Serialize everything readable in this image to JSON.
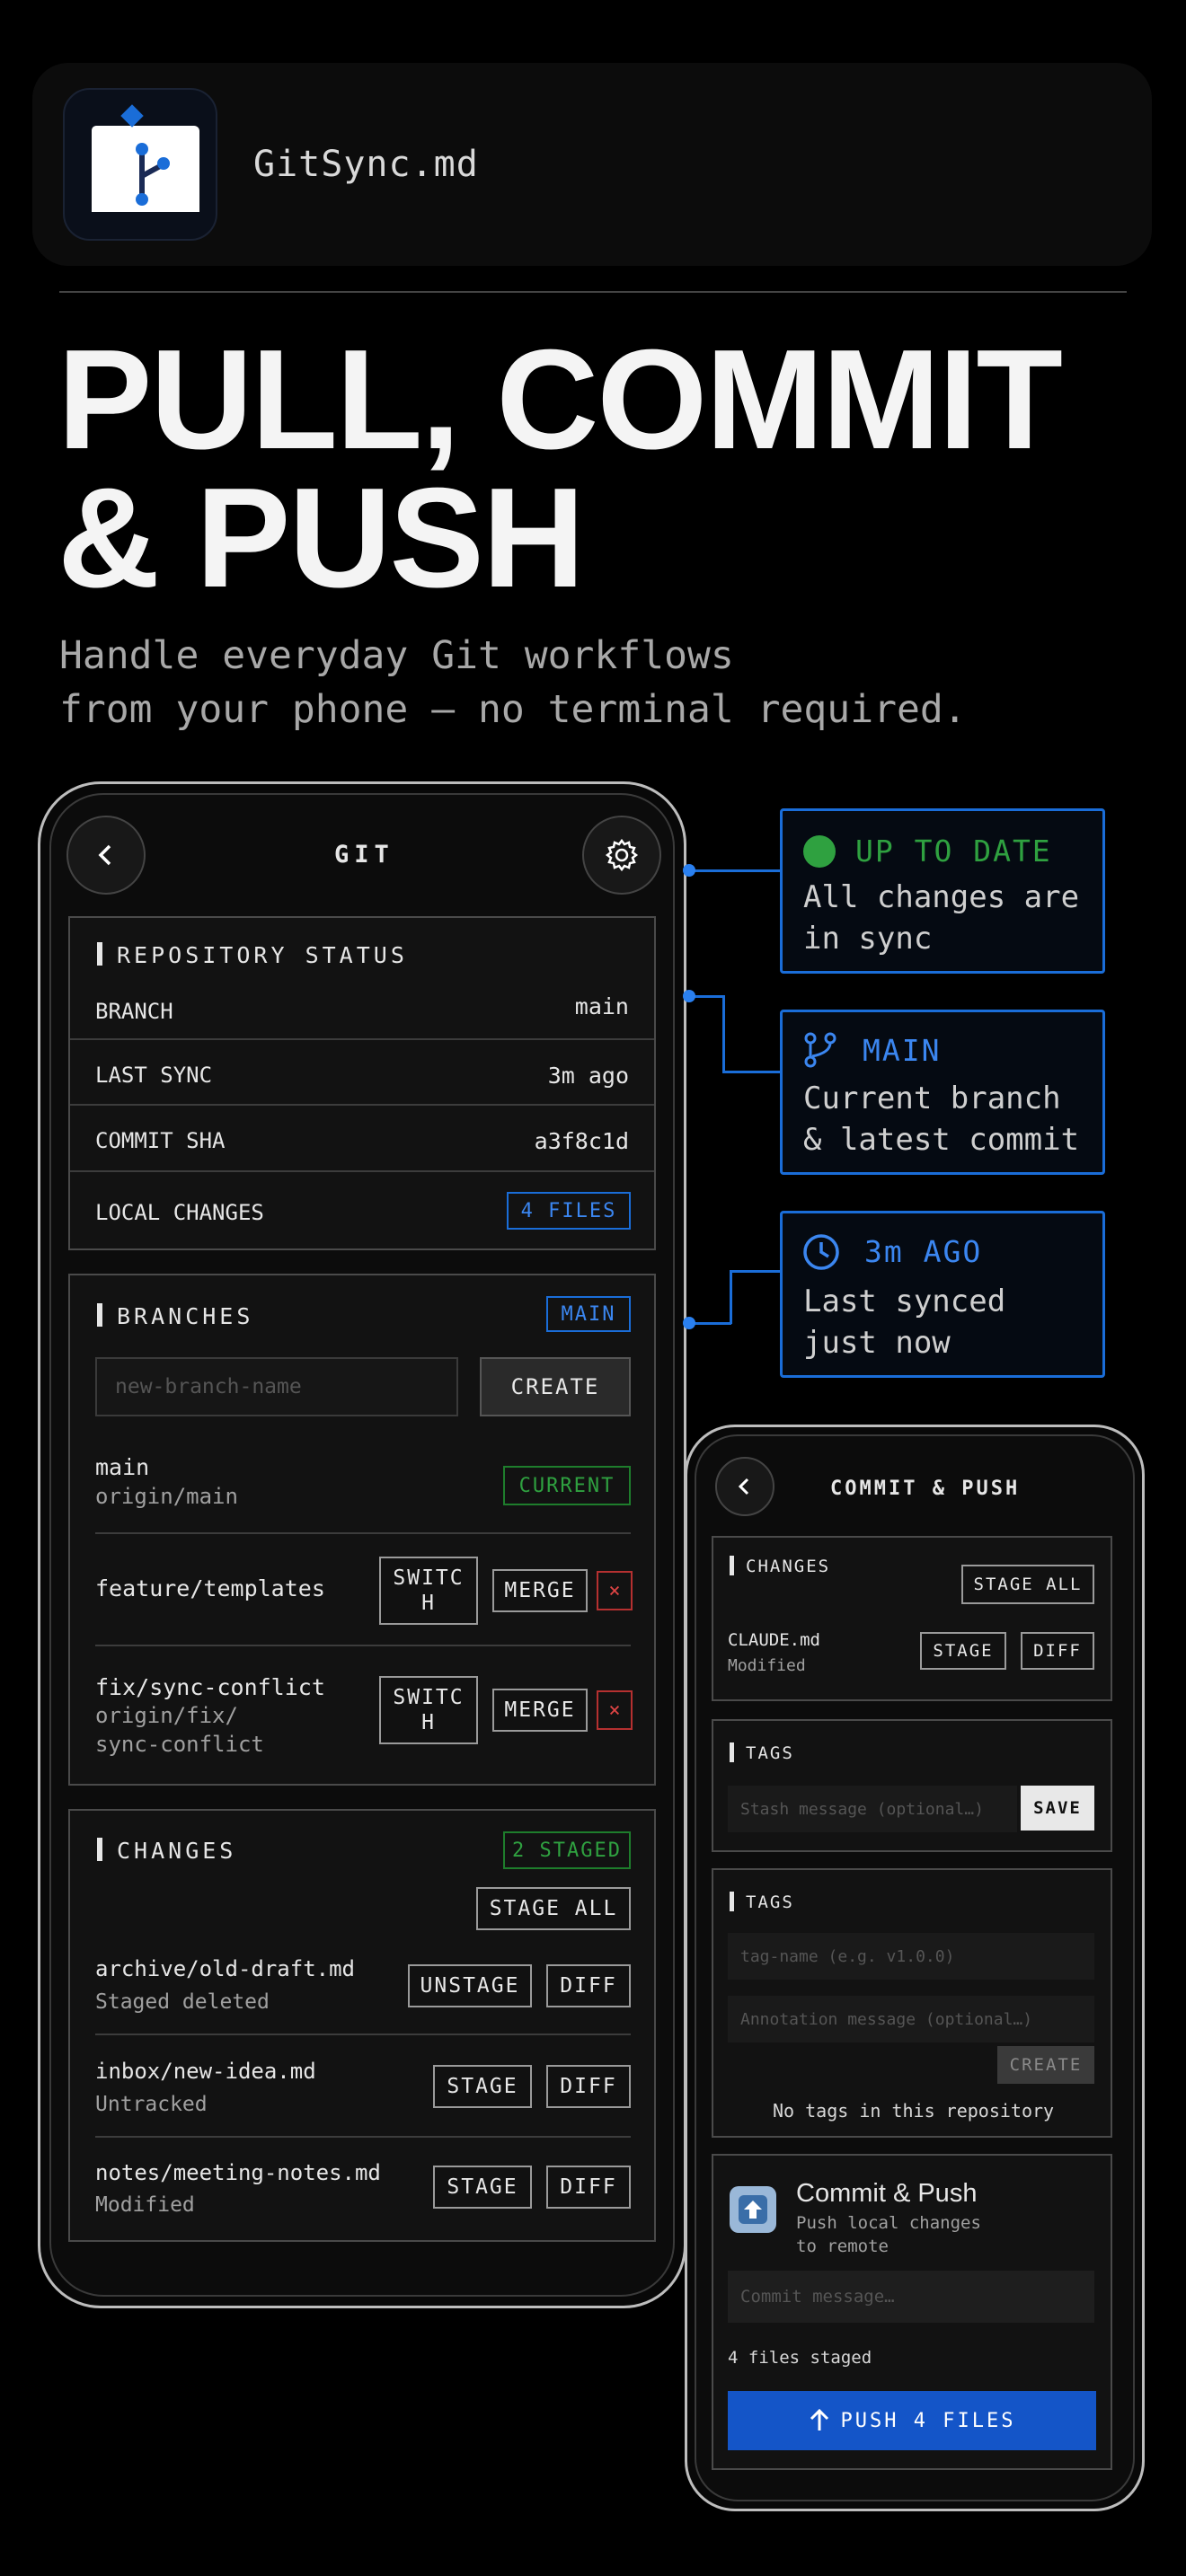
{
  "app": {
    "name": "GitSync.md"
  },
  "hero": {
    "headline_line1": "PULL, COMMIT",
    "headline_line2": "& PUSH",
    "subhead_line1": "Handle everyday Git workflows",
    "subhead_line2": "from your phone — no terminal required."
  },
  "git_screen": {
    "title": "GIT",
    "repo_status": {
      "heading": "REPOSITORY STATUS",
      "rows": [
        {
          "label": "BRANCH",
          "value": "main"
        },
        {
          "label": "LAST SYNC",
          "value": "3m ago"
        },
        {
          "label": "COMMIT SHA",
          "value": "a3f8c1d"
        },
        {
          "label": "LOCAL CHANGES",
          "value": "4 FILES"
        }
      ]
    },
    "branches": {
      "heading": "BRANCHES",
      "badge": "MAIN",
      "input_placeholder": "new-branch-name",
      "create_label": "CREATE",
      "items": [
        {
          "name": "main",
          "remote": "origin/main",
          "status": "CURRENT"
        },
        {
          "name": "feature/templates",
          "switch": "SWITC\nH",
          "merge": "MERGE",
          "delete": "×"
        },
        {
          "name": "fix/sync-conflict",
          "remote_line1": "origin/fix/",
          "remote_line2": "sync-conflict",
          "switch": "SWITC\nH",
          "merge": "MERGE",
          "delete": "×"
        }
      ]
    },
    "changes": {
      "heading": "CHANGES",
      "badge": "2 STAGED",
      "stage_all": "STAGE ALL",
      "files": [
        {
          "name": "archive/old-draft.md",
          "status": "Staged deleted",
          "action": "UNSTAGE",
          "diff": "DIFF"
        },
        {
          "name": "inbox/new-idea.md",
          "status": "Untracked",
          "action": "STAGE",
          "diff": "DIFF"
        },
        {
          "name": "notes/meeting-notes.md",
          "status": "Modified",
          "action": "STAGE",
          "diff": "DIFF"
        }
      ]
    }
  },
  "callouts": [
    {
      "title": "UP TO DATE",
      "body_line1": "All changes are",
      "body_line2": "in sync",
      "color": "#2fa140",
      "icon": "green-dot-icon"
    },
    {
      "title": "MAIN",
      "body_line1": "Current branch",
      "body_line2": "& latest commit",
      "color": "#3b86f0",
      "icon": "branch-icon"
    },
    {
      "title": "3m AGO",
      "body_line1": "Last synced",
      "body_line2": "just now",
      "color": "#3b86f0",
      "icon": "clock-icon"
    }
  ],
  "commit_screen": {
    "title": "COMMIT & PUSH",
    "changes": {
      "heading": "CHANGES",
      "stage_all": "STAGE ALL",
      "file": {
        "name": "CLAUDE.md",
        "status": "Modified",
        "stage": "STAGE",
        "diff": "DIFF"
      }
    },
    "stash": {
      "heading": "TAGS",
      "placeholder": "Stash message (optional…)",
      "save": "SAVE"
    },
    "tags": {
      "heading": "TAGS",
      "tag_placeholder": "tag-name (e.g. v1.0.0)",
      "annotation_placeholder": "Annotation message (optional…)",
      "create": "CREATE",
      "empty": "No tags in this repository"
    },
    "commit": {
      "title": "Commit & Push",
      "subtitle_line1": "Push local changes",
      "subtitle_line2": "to remote",
      "placeholder": "Commit message…",
      "staged_count": "4 files staged",
      "push_label": "PUSH 4 FILES"
    }
  },
  "colors": {
    "accent_blue": "#1a6dd8",
    "accent_green": "#2fa140",
    "danger_red": "#e04545"
  }
}
